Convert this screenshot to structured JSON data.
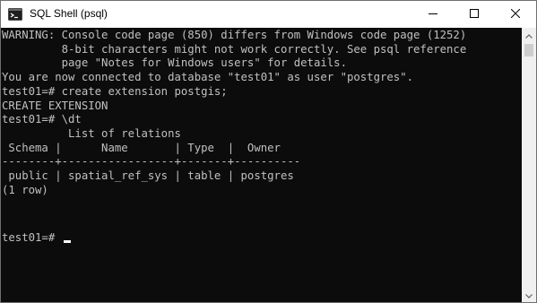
{
  "window": {
    "title": "SQL Shell (psql)",
    "icon": "powershell-console-icon",
    "controls": {
      "minimize_icon": "minimize-icon",
      "maximize_icon": "maximize-icon",
      "close_icon": "close-icon"
    }
  },
  "terminal": {
    "text": "WARNING: Console code page (850) differs from Windows code page (1252)\n         8-bit characters might not work correctly. See psql reference\n         page \"Notes for Windows users\" for details.\nYou are now connected to database \"test01\" as user \"postgres\".\ntest01=# create extension postgis;\nCREATE EXTENSION\ntest01=# \\dt\n          List of relations\n Schema |      Name       | Type  |  Owner\n--------+-----------------+-------+----------\n public | spatial_ref_sys | table | postgres\n(1 row)\n",
    "prompt": "test01=# "
  },
  "scrollbar": {
    "up_icon": "scroll-up-arrow-icon",
    "down_icon": "scroll-down-arrow-icon"
  }
}
